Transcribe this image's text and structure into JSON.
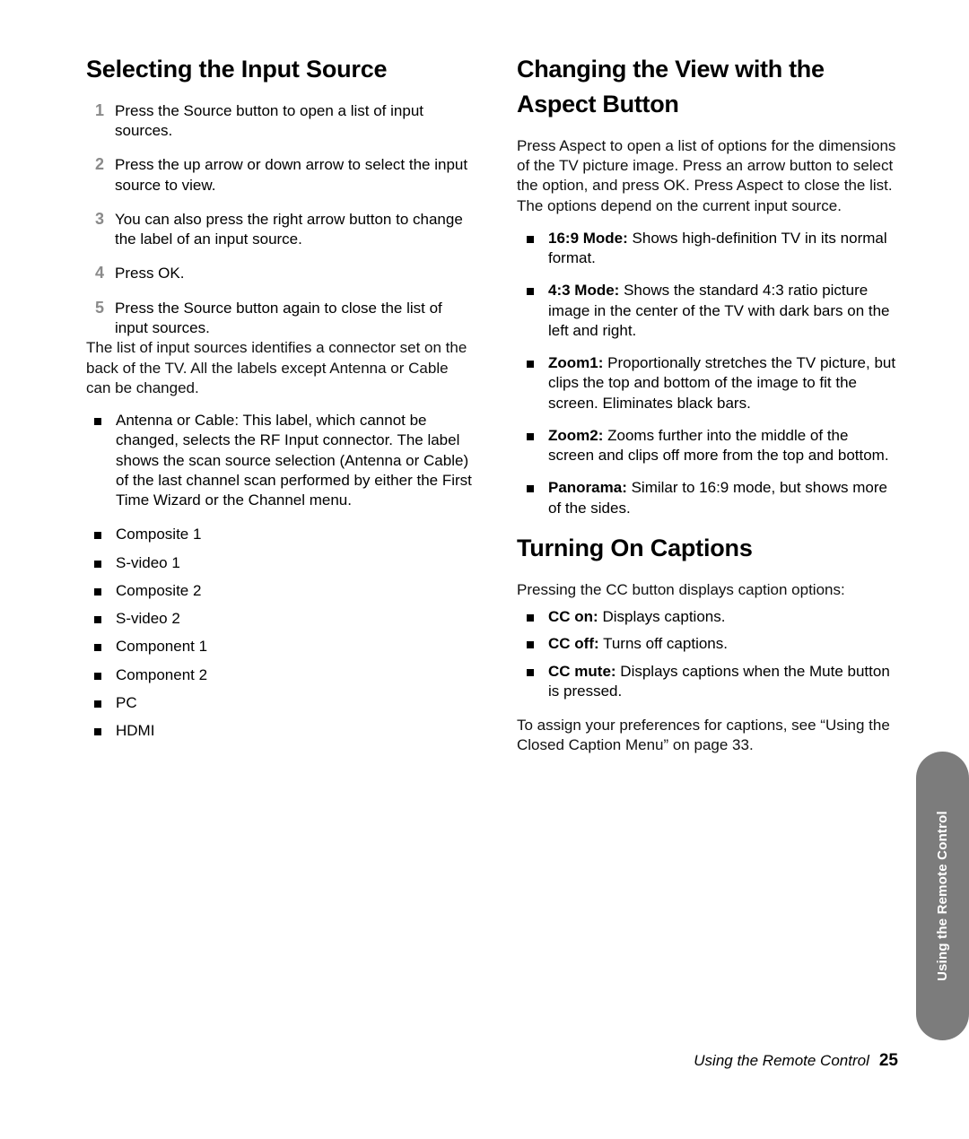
{
  "page": {
    "number": "25",
    "footer_title": "Using the Remote Control",
    "side_tab_label": "Using the Remote Control",
    "side_tab_color": "#7c7c7c",
    "step_number_color": "#8a8a8a"
  },
  "left_column": {
    "heading": "Selecting the Input Source",
    "steps": [
      {
        "num": "1",
        "text": "Press the Source button to open a list of input sources."
      },
      {
        "num": "2",
        "text": "Press the up arrow or down arrow to select the input source to view."
      },
      {
        "num": "3",
        "text": "You can also press the right arrow button to change the label of an input source."
      },
      {
        "num": "4",
        "text": "Press OK."
      },
      {
        "num": "5",
        "text": "Press the Source button again to close the list of input sources."
      }
    ],
    "paragraph": "The list of input sources identifies a connector set on the back of the TV. All the labels except Antenna or Cable can be changed.",
    "antenna_bullet": "Antenna or Cable: This label, which cannot be changed, selects the RF Input connector. The label shows the scan source selection (Antenna or Cable) of the last channel scan performed by either the First Time Wizard or the Channel menu.",
    "source_list": [
      "Composite 1",
      "S-video 1",
      "Composite 2",
      "S-video 2",
      "Component 1",
      "Component 2",
      "PC",
      "HDMI"
    ]
  },
  "right_column": {
    "aspect": {
      "heading": "Changing the View with the Aspect Button",
      "intro": "Press Aspect to open a list of options for the dimensions of the TV picture image. Press an arrow button to select the option, and press OK. Press Aspect to close the list. The options depend on the current input source.",
      "modes": [
        {
          "label": "16:9 Mode:",
          "desc": " Shows high-definition TV in its normal format."
        },
        {
          "label": "4:3 Mode:",
          "desc": " Shows the standard 4:3 ratio picture image in the center of the TV with dark bars on the left and right."
        },
        {
          "label": "Zoom1:",
          "desc": " Proportionally stretches the TV picture, but clips the top and bottom of the image to fit the screen. Eliminates black bars."
        },
        {
          "label": "Zoom2:",
          "desc": " Zooms further into the middle of the screen and clips off more from the top and bottom."
        },
        {
          "label": "Panorama:",
          "desc": " Similar to 16:9 mode, but shows more of the sides."
        }
      ]
    },
    "captions": {
      "heading": "Turning On Captions",
      "intro": "Pressing the CC button displays caption options:",
      "options": [
        {
          "label": "CC on:",
          "desc": " Displays captions."
        },
        {
          "label": "CC off:",
          "desc": " Turns off captions."
        },
        {
          "label": "CC mute:",
          "desc": " Displays captions when the Mute button is pressed."
        }
      ],
      "closing": "To assign your preferences for captions, see “Using the Closed Caption Menu” on page 33."
    }
  }
}
